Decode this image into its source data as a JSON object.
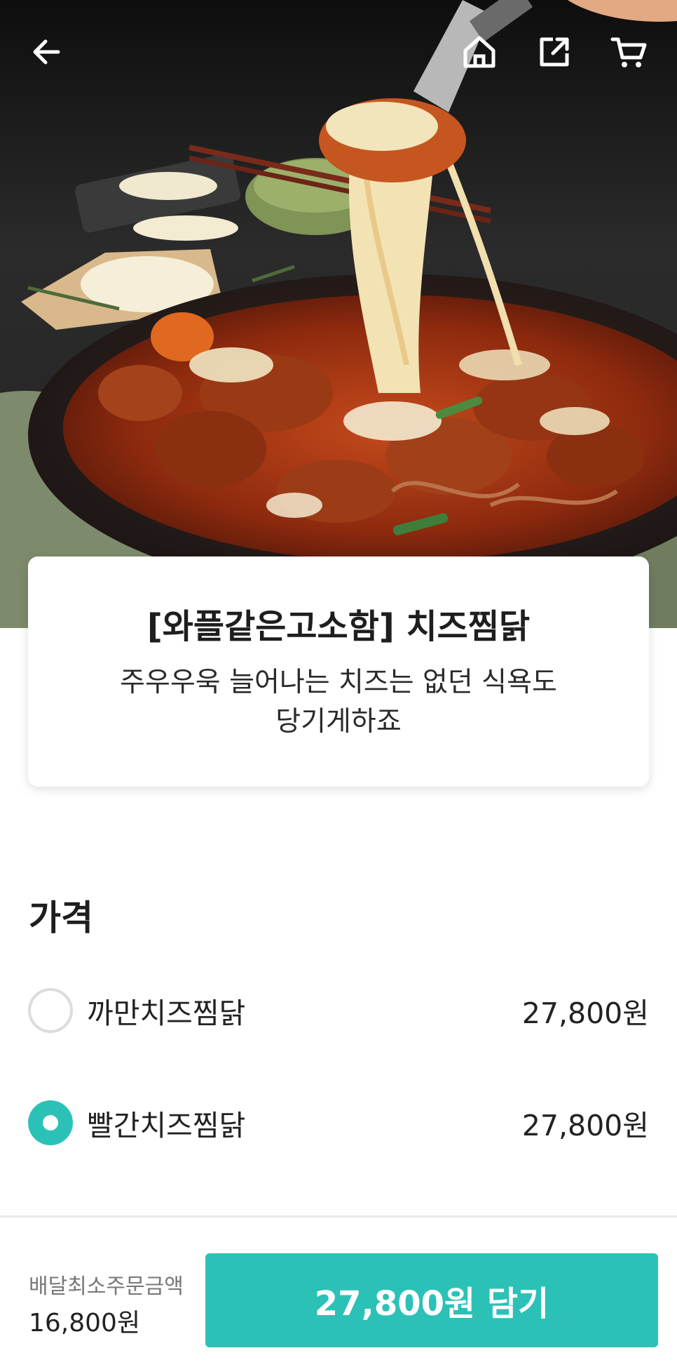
{
  "product": {
    "title": "[와플같은고소함] 치즈찜닭",
    "description": "주우우욱 늘어나는 치즈는 없던 식욕도 당기게하죠"
  },
  "icons": {
    "back": "arrow-left-icon",
    "home": "home-icon",
    "share": "share-icon",
    "cart": "cart-icon"
  },
  "price_section": {
    "title": "가격",
    "options": [
      {
        "name": "까만치즈찜닭",
        "price": "27,800원",
        "selected": false
      },
      {
        "name": "빨간치즈찜닭",
        "price": "27,800원",
        "selected": true
      }
    ]
  },
  "footer": {
    "min_order_label": "배달최소주문금액",
    "min_order_value": "16,800원",
    "add_button_label": "27,800원 담기"
  },
  "colors": {
    "accent": "#2cc1b7",
    "text": "#222222",
    "muted": "#777777"
  }
}
